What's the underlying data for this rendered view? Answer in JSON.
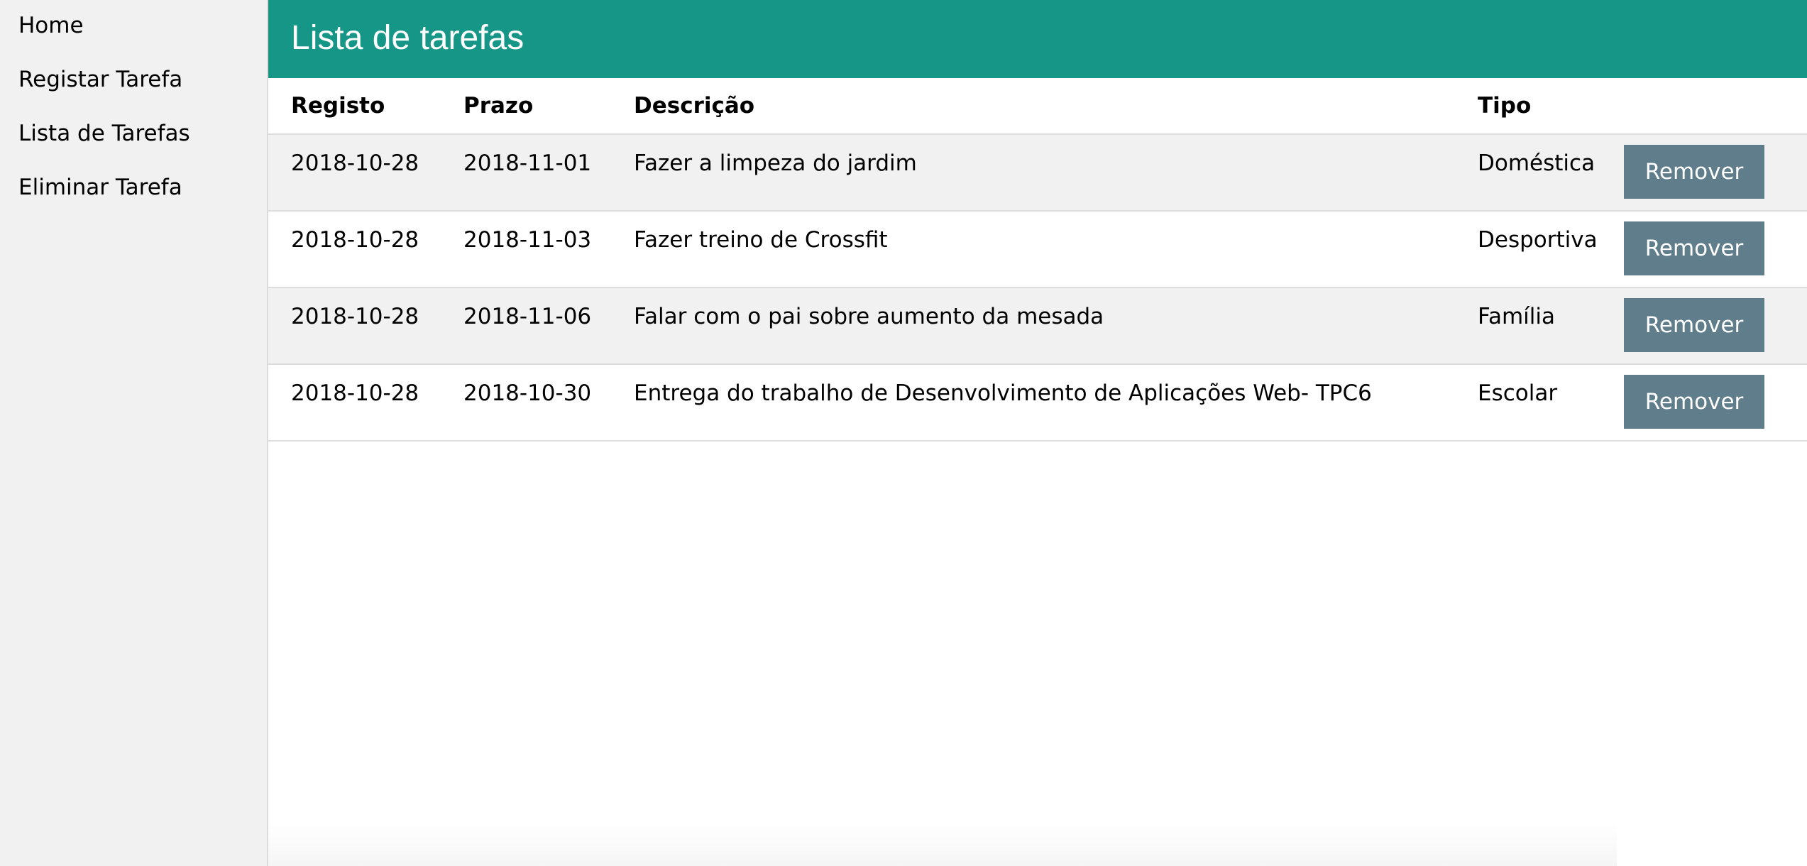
{
  "sidebar": {
    "items": [
      {
        "label": "Home"
      },
      {
        "label": "Registar Tarefa"
      },
      {
        "label": "Lista de Tarefas"
      },
      {
        "label": "Eliminar Tarefa"
      }
    ]
  },
  "header": {
    "title": "Lista de tarefas"
  },
  "table": {
    "columns": [
      "Registo",
      "Prazo",
      "Descrição",
      "Tipo"
    ],
    "rows": [
      {
        "registo": "2018-10-28",
        "prazo": "2018-11-01",
        "descricao": "Fazer a limpeza do jardim",
        "tipo": "Doméstica",
        "action": "Remover"
      },
      {
        "registo": "2018-10-28",
        "prazo": "2018-11-03",
        "descricao": "Fazer treino de Crossfit",
        "tipo": "Desportiva",
        "action": "Remover"
      },
      {
        "registo": "2018-10-28",
        "prazo": "2018-11-06",
        "descricao": "Falar com o pai sobre aumento da mesada",
        "tipo": "Família",
        "action": "Remover"
      },
      {
        "registo": "2018-10-28",
        "prazo": "2018-10-30",
        "descricao": "Entrega do trabalho de Desenvolvimento de Aplicações Web- TPC6",
        "tipo": "Escolar",
        "action": "Remover"
      }
    ]
  },
  "colors": {
    "header_bg": "#169686",
    "button_bg": "#607d8b",
    "sidebar_bg": "#f1f1f1",
    "row_alt_bg": "#f1f1f1"
  }
}
